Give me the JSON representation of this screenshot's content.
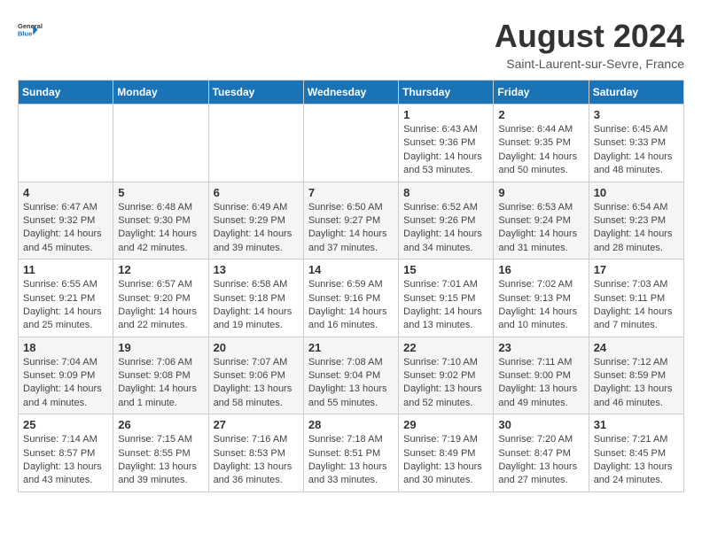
{
  "header": {
    "logo_text_general": "General",
    "logo_text_blue": "Blue",
    "month_year": "August 2024",
    "location": "Saint-Laurent-sur-Sevre, France"
  },
  "days_of_week": [
    "Sunday",
    "Monday",
    "Tuesday",
    "Wednesday",
    "Thursday",
    "Friday",
    "Saturday"
  ],
  "weeks": [
    [
      {
        "day": "",
        "info": ""
      },
      {
        "day": "",
        "info": ""
      },
      {
        "day": "",
        "info": ""
      },
      {
        "day": "",
        "info": ""
      },
      {
        "day": "1",
        "info": "Sunrise: 6:43 AM\nSunset: 9:36 PM\nDaylight: 14 hours\nand 53 minutes."
      },
      {
        "day": "2",
        "info": "Sunrise: 6:44 AM\nSunset: 9:35 PM\nDaylight: 14 hours\nand 50 minutes."
      },
      {
        "day": "3",
        "info": "Sunrise: 6:45 AM\nSunset: 9:33 PM\nDaylight: 14 hours\nand 48 minutes."
      }
    ],
    [
      {
        "day": "4",
        "info": "Sunrise: 6:47 AM\nSunset: 9:32 PM\nDaylight: 14 hours\nand 45 minutes."
      },
      {
        "day": "5",
        "info": "Sunrise: 6:48 AM\nSunset: 9:30 PM\nDaylight: 14 hours\nand 42 minutes."
      },
      {
        "day": "6",
        "info": "Sunrise: 6:49 AM\nSunset: 9:29 PM\nDaylight: 14 hours\nand 39 minutes."
      },
      {
        "day": "7",
        "info": "Sunrise: 6:50 AM\nSunset: 9:27 PM\nDaylight: 14 hours\nand 37 minutes."
      },
      {
        "day": "8",
        "info": "Sunrise: 6:52 AM\nSunset: 9:26 PM\nDaylight: 14 hours\nand 34 minutes."
      },
      {
        "day": "9",
        "info": "Sunrise: 6:53 AM\nSunset: 9:24 PM\nDaylight: 14 hours\nand 31 minutes."
      },
      {
        "day": "10",
        "info": "Sunrise: 6:54 AM\nSunset: 9:23 PM\nDaylight: 14 hours\nand 28 minutes."
      }
    ],
    [
      {
        "day": "11",
        "info": "Sunrise: 6:55 AM\nSunset: 9:21 PM\nDaylight: 14 hours\nand 25 minutes."
      },
      {
        "day": "12",
        "info": "Sunrise: 6:57 AM\nSunset: 9:20 PM\nDaylight: 14 hours\nand 22 minutes."
      },
      {
        "day": "13",
        "info": "Sunrise: 6:58 AM\nSunset: 9:18 PM\nDaylight: 14 hours\nand 19 minutes."
      },
      {
        "day": "14",
        "info": "Sunrise: 6:59 AM\nSunset: 9:16 PM\nDaylight: 14 hours\nand 16 minutes."
      },
      {
        "day": "15",
        "info": "Sunrise: 7:01 AM\nSunset: 9:15 PM\nDaylight: 14 hours\nand 13 minutes."
      },
      {
        "day": "16",
        "info": "Sunrise: 7:02 AM\nSunset: 9:13 PM\nDaylight: 14 hours\nand 10 minutes."
      },
      {
        "day": "17",
        "info": "Sunrise: 7:03 AM\nSunset: 9:11 PM\nDaylight: 14 hours\nand 7 minutes."
      }
    ],
    [
      {
        "day": "18",
        "info": "Sunrise: 7:04 AM\nSunset: 9:09 PM\nDaylight: 14 hours\nand 4 minutes."
      },
      {
        "day": "19",
        "info": "Sunrise: 7:06 AM\nSunset: 9:08 PM\nDaylight: 14 hours\nand 1 minute."
      },
      {
        "day": "20",
        "info": "Sunrise: 7:07 AM\nSunset: 9:06 PM\nDaylight: 13 hours\nand 58 minutes."
      },
      {
        "day": "21",
        "info": "Sunrise: 7:08 AM\nSunset: 9:04 PM\nDaylight: 13 hours\nand 55 minutes."
      },
      {
        "day": "22",
        "info": "Sunrise: 7:10 AM\nSunset: 9:02 PM\nDaylight: 13 hours\nand 52 minutes."
      },
      {
        "day": "23",
        "info": "Sunrise: 7:11 AM\nSunset: 9:00 PM\nDaylight: 13 hours\nand 49 minutes."
      },
      {
        "day": "24",
        "info": "Sunrise: 7:12 AM\nSunset: 8:59 PM\nDaylight: 13 hours\nand 46 minutes."
      }
    ],
    [
      {
        "day": "25",
        "info": "Sunrise: 7:14 AM\nSunset: 8:57 PM\nDaylight: 13 hours\nand 43 minutes."
      },
      {
        "day": "26",
        "info": "Sunrise: 7:15 AM\nSunset: 8:55 PM\nDaylight: 13 hours\nand 39 minutes."
      },
      {
        "day": "27",
        "info": "Sunrise: 7:16 AM\nSunset: 8:53 PM\nDaylight: 13 hours\nand 36 minutes."
      },
      {
        "day": "28",
        "info": "Sunrise: 7:18 AM\nSunset: 8:51 PM\nDaylight: 13 hours\nand 33 minutes."
      },
      {
        "day": "29",
        "info": "Sunrise: 7:19 AM\nSunset: 8:49 PM\nDaylight: 13 hours\nand 30 minutes."
      },
      {
        "day": "30",
        "info": "Sunrise: 7:20 AM\nSunset: 8:47 PM\nDaylight: 13 hours\nand 27 minutes."
      },
      {
        "day": "31",
        "info": "Sunrise: 7:21 AM\nSunset: 8:45 PM\nDaylight: 13 hours\nand 24 minutes."
      }
    ]
  ]
}
